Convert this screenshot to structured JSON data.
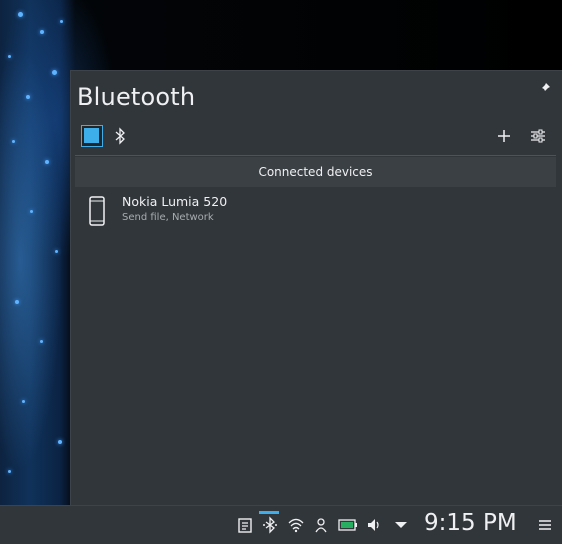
{
  "popup": {
    "title": "Bluetooth",
    "section_header": "Connected devices",
    "devices": [
      {
        "name": "Nokia Lumia 520",
        "services": "Send file, Network",
        "icon": "phone-icon"
      }
    ]
  },
  "toolbar": {
    "bluetooth_enabled": true,
    "add_icon": "plus-icon",
    "config_icon": "settings-icon"
  },
  "taskbar": {
    "clock": "9:15 PM",
    "tray_icons": [
      "clipboard-icon",
      "bluetooth-icon",
      "wifi-icon",
      "user-icon",
      "battery-icon",
      "volume-icon",
      "chevron-down-icon"
    ]
  },
  "colors": {
    "accent": "#3daee9",
    "panel": "#31363b",
    "text": "#eff0f1"
  }
}
